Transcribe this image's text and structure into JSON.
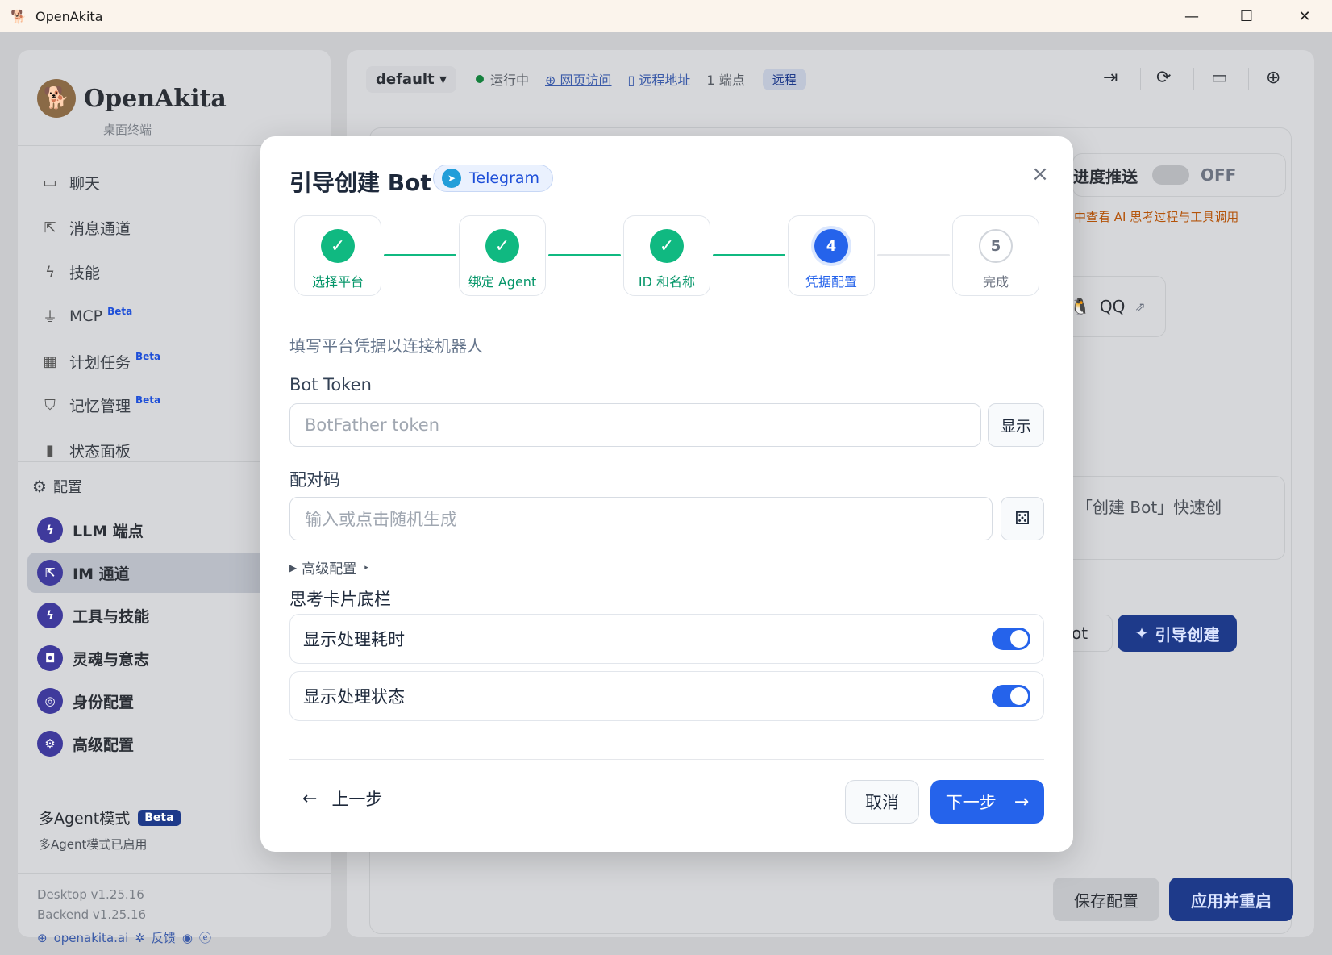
{
  "window": {
    "title": "OpenAkita",
    "app_icon": "akita-logo-icon"
  },
  "sidebar": {
    "brand_name": "OpenAkita",
    "brand_sub": "桌面终端",
    "nav": [
      {
        "label": "聊天",
        "icon": "chat-icon"
      },
      {
        "label": "消息通道",
        "icon": "share-icon"
      },
      {
        "label": "技能",
        "icon": "bolt-icon"
      },
      {
        "label": "MCP",
        "icon": "plug-icon",
        "beta": "Beta"
      },
      {
        "label": "计划任务",
        "icon": "calendar-icon",
        "beta": "Beta"
      },
      {
        "label": "记忆管理",
        "icon": "brain-icon",
        "beta": "Beta"
      },
      {
        "label": "状态面板",
        "icon": "chart-icon"
      }
    ],
    "config_heading": "配置",
    "config_items": [
      {
        "label": "LLM 端点"
      },
      {
        "label": "IM 通道"
      },
      {
        "label": "工具与技能"
      },
      {
        "label": "灵魂与意志"
      },
      {
        "label": "身份配置"
      },
      {
        "label": "高级配置"
      }
    ],
    "multi_agent": {
      "title": "多Agent模式",
      "badge": "Beta",
      "status": "多Agent模式已启用"
    },
    "desktop_version": "Desktop v1.25.16",
    "backend_version": "Backend v1.25.16",
    "links": {
      "site": "openakita.ai",
      "feedback": "反馈"
    }
  },
  "topbar": {
    "profile": "default",
    "status": "运行中",
    "web_access": "网页访问",
    "remote_address": "远程地址",
    "endpoints": "1 端点",
    "remote_badge": "远程"
  },
  "background": {
    "progress_push": "进度推送",
    "off": "OFF",
    "hint": "中查看 AI 思考过程与工具调用",
    "qq": "QQ",
    "create_hint": "「创建 Bot」快速创",
    "bot_partial": "ot",
    "guide_create": "引导创建",
    "save": "保存配置",
    "apply": "应用并重启"
  },
  "modal": {
    "title": "引导创建 Bot",
    "platform_badge": "Telegram",
    "steps": [
      {
        "label": "选择平台",
        "state": "done"
      },
      {
        "label": "绑定 Agent",
        "state": "done"
      },
      {
        "label": "ID 和名称",
        "state": "done"
      },
      {
        "label": "凭据配置",
        "state": "current",
        "num": "4"
      },
      {
        "label": "完成",
        "state": "todo",
        "num": "5"
      }
    ],
    "description": "填写平台凭据以连接机器人",
    "token_label": "Bot Token",
    "token_placeholder": "BotFather token",
    "show_button": "显示",
    "pair_label": "配对码",
    "pair_placeholder": "输入或点击随机生成",
    "advanced": "高级配置",
    "section_title": "思考卡片底栏",
    "toggles": [
      {
        "label": "显示处理耗时",
        "on": true
      },
      {
        "label": "显示处理状态",
        "on": true
      }
    ],
    "prev": "上一步",
    "cancel": "取消",
    "next": "下一步"
  },
  "colors": {
    "accent": "#2563eb",
    "success": "#10b981",
    "telegram": "#229ed9"
  }
}
